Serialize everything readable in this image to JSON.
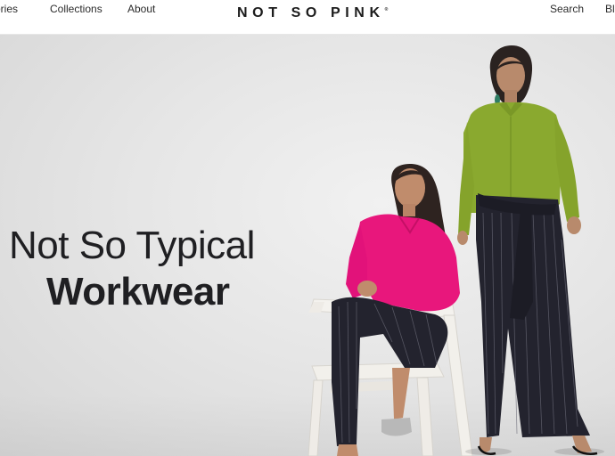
{
  "header": {
    "nav_left": [
      "ssories",
      "Collections",
      "About"
    ],
    "logo": "NOT SO PINK",
    "logo_mark": "®",
    "nav_right": [
      "Search",
      "Bl"
    ]
  },
  "hero": {
    "headline_line1": "Not So Typical",
    "headline_line2": "Workwear",
    "image_alt": "Two women modelling workwear, one seated in a pink shirt and striped trousers, one standing in a green shirt and striped trousers"
  },
  "colors": {
    "pink_shirt": "#e8177c",
    "green_shirt": "#8aa92f",
    "trousers": "#23232e",
    "background": "#e6e6e6",
    "chair": "#f4f2ee",
    "text": "#1f1f22"
  }
}
